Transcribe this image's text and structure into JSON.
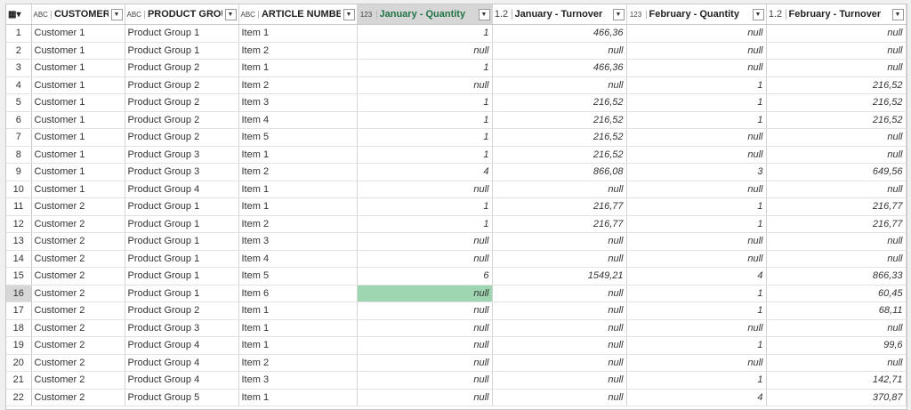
{
  "header": {
    "corner_icon": "table-icon",
    "columns": [
      {
        "type": "ABC",
        "label": "CUSTOMER"
      },
      {
        "type": "ABC",
        "label": "PRODUCT GROUP"
      },
      {
        "type": "ABC",
        "label": "ARTICLE NUMBER"
      },
      {
        "type": "123",
        "label": "January - Quantity"
      },
      {
        "type": "1.2",
        "label": "January - Turnover"
      },
      {
        "type": "123",
        "label": "February - Quantity"
      },
      {
        "type": "1.2",
        "label": "February - Turnover"
      }
    ]
  },
  "active_column": 3,
  "selected_row": 16,
  "rows": [
    [
      "1",
      "Customer 1",
      "Product Group 1",
      "Item 1",
      "1",
      "466,36",
      "null",
      "null"
    ],
    [
      "2",
      "Customer 1",
      "Product Group 1",
      "Item 2",
      "null",
      "null",
      "null",
      "null"
    ],
    [
      "3",
      "Customer 1",
      "Product Group 2",
      "Item 1",
      "1",
      "466,36",
      "null",
      "null"
    ],
    [
      "4",
      "Customer 1",
      "Product Group 2",
      "Item 2",
      "null",
      "null",
      "1",
      "216,52"
    ],
    [
      "5",
      "Customer 1",
      "Product Group 2",
      "Item 3",
      "1",
      "216,52",
      "1",
      "216,52"
    ],
    [
      "6",
      "Customer 1",
      "Product Group 2",
      "Item 4",
      "1",
      "216,52",
      "1",
      "216,52"
    ],
    [
      "7",
      "Customer 1",
      "Product Group 2",
      "Item 5",
      "1",
      "216,52",
      "null",
      "null"
    ],
    [
      "8",
      "Customer 1",
      "Product Group 3",
      "Item 1",
      "1",
      "216,52",
      "null",
      "null"
    ],
    [
      "9",
      "Customer 1",
      "Product Group 3",
      "Item 2",
      "4",
      "866,08",
      "3",
      "649,56"
    ],
    [
      "10",
      "Customer 1",
      "Product Group 4",
      "Item 1",
      "null",
      "null",
      "null",
      "null"
    ],
    [
      "11",
      "Customer 2",
      "Product Group 1",
      "Item 1",
      "1",
      "216,77",
      "1",
      "216,77"
    ],
    [
      "12",
      "Customer 2",
      "Product Group 1",
      "Item 2",
      "1",
      "216,77",
      "1",
      "216,77"
    ],
    [
      "13",
      "Customer 2",
      "Product Group 1",
      "Item 3",
      "null",
      "null",
      "null",
      "null"
    ],
    [
      "14",
      "Customer 2",
      "Product Group 1",
      "Item 4",
      "null",
      "null",
      "null",
      "null"
    ],
    [
      "15",
      "Customer 2",
      "Product Group 1",
      "Item 5",
      "6",
      "1549,21",
      "4",
      "866,33"
    ],
    [
      "16",
      "Customer 2",
      "Product Group 1",
      "Item 6",
      "null",
      "null",
      "1",
      "60,45"
    ],
    [
      "17",
      "Customer 2",
      "Product Group 2",
      "Item 1",
      "null",
      "null",
      "1",
      "68,11"
    ],
    [
      "18",
      "Customer 2",
      "Product Group 3",
      "Item 1",
      "null",
      "null",
      "null",
      "null"
    ],
    [
      "19",
      "Customer 2",
      "Product Group 4",
      "Item 1",
      "null",
      "null",
      "1",
      "99,6"
    ],
    [
      "20",
      "Customer 2",
      "Product Group 4",
      "Item 2",
      "null",
      "null",
      "null",
      "null"
    ],
    [
      "21",
      "Customer 2",
      "Product Group 4",
      "Item 3",
      "null",
      "null",
      "1",
      "142,71"
    ],
    [
      "22",
      "Customer 2",
      "Product Group 5",
      "Item 1",
      "null",
      "null",
      "4",
      "370,87"
    ]
  ],
  "colors": {
    "active_header_text": "#217346",
    "selected_cell": "#9fd6b2",
    "selected_index": "#d6d6d6"
  }
}
